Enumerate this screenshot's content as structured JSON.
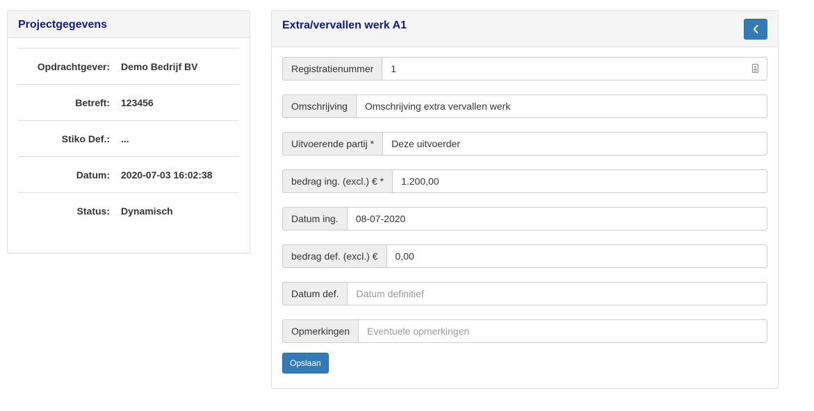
{
  "project": {
    "title": "Projectgegevens",
    "rows": [
      {
        "label": "Opdrachtgever:",
        "value": "Demo Bedrijf BV"
      },
      {
        "label": "Betreft:",
        "value": "123456"
      },
      {
        "label": "Stiko Def.:",
        "value": "..."
      },
      {
        "label": "Datum:",
        "value": "2020-07-03 16:02:38"
      },
      {
        "label": "Status:",
        "value": "Dynamisch"
      }
    ]
  },
  "form": {
    "title": "Extra/vervallen werk A1",
    "back_icon": "chevron-left-icon",
    "fields": {
      "registratienummer": {
        "label": "Registratienummer",
        "value": "1",
        "placeholder": "",
        "icon": "id-card-icon"
      },
      "omschrijving": {
        "label": "Omschrijving",
        "value": "Omschrijving extra vervallen werk",
        "placeholder": ""
      },
      "uitvoerende_partij": {
        "label": "Uitvoerende partij *",
        "value": "Deze uitvoerder",
        "placeholder": ""
      },
      "bedrag_ing": {
        "label": "bedrag ing. (excl.) € *",
        "value": "1.200,00",
        "placeholder": ""
      },
      "datum_ing": {
        "label": "Datum ing.",
        "value": "08-07-2020",
        "placeholder": ""
      },
      "bedrag_def": {
        "label": "bedrag def. (excl.) €",
        "value": "0,00",
        "placeholder": ""
      },
      "datum_def": {
        "label": "Datum def.",
        "value": "",
        "placeholder": "Datum definitief"
      },
      "opmerkingen": {
        "label": "Opmerkingen",
        "value": "",
        "placeholder": "Eventuele opmerkingen"
      }
    },
    "save_label": "Opslaan"
  },
  "colors": {
    "title": "#101a7a",
    "primary": "#337ab7",
    "addon_bg": "#eeeeee",
    "border": "#dddddd"
  }
}
